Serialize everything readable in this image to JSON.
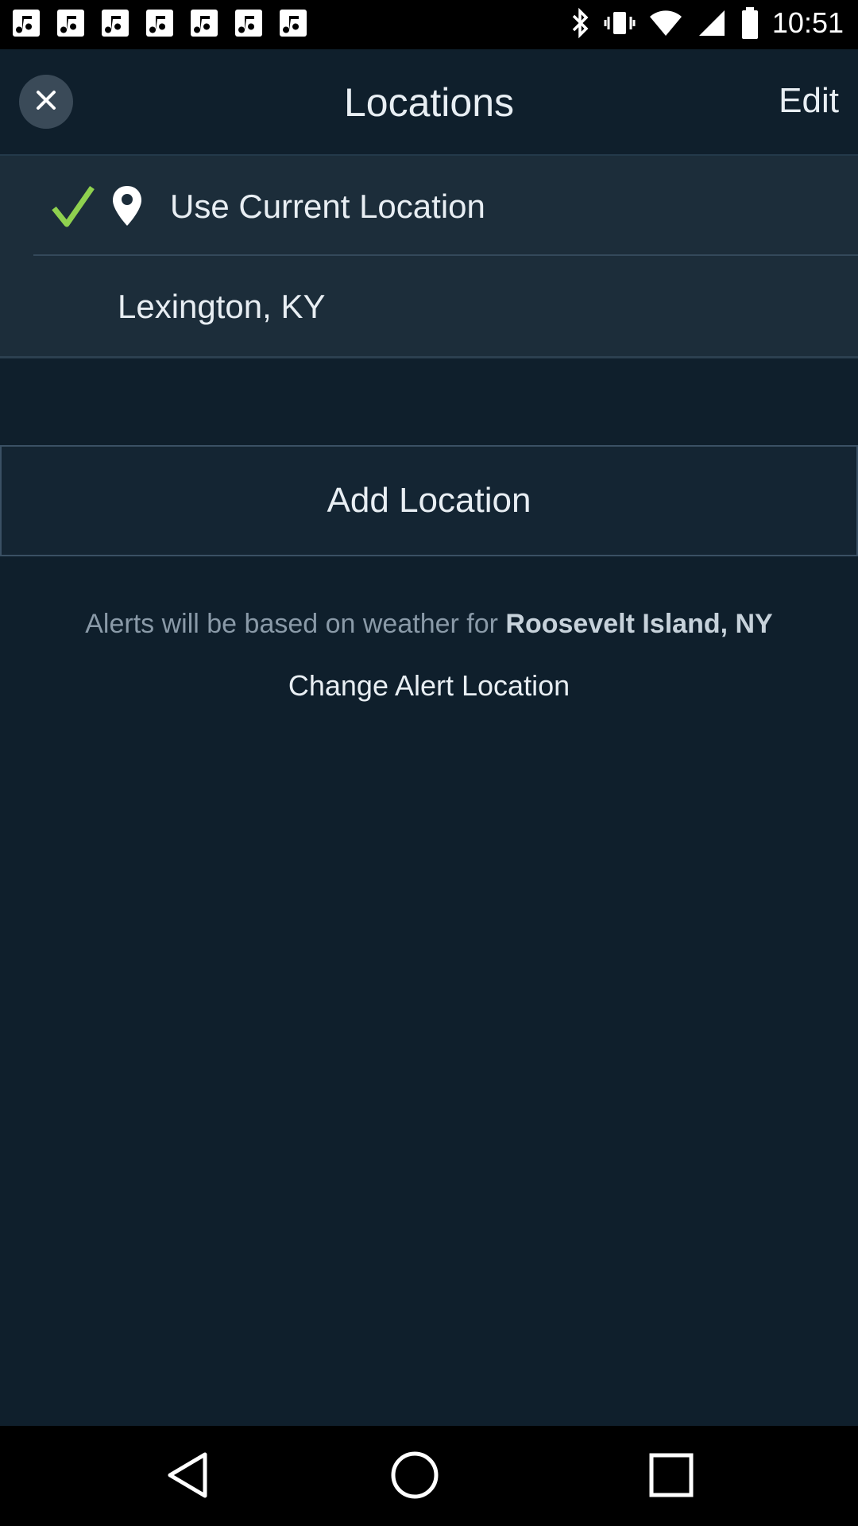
{
  "status_bar": {
    "time": "10:51",
    "notification_icons": [
      "music-note-icon",
      "music-note-icon",
      "music-note-icon",
      "music-note-icon",
      "music-note-icon",
      "music-note-icon",
      "music-note-icon"
    ],
    "right_icons": [
      "bluetooth-icon",
      "vibrate-icon",
      "wifi-icon",
      "signal-icon",
      "battery-icon"
    ]
  },
  "header": {
    "title": "Locations",
    "edit_label": "Edit"
  },
  "locations": {
    "current_label": "Use Current Location",
    "items": [
      {
        "label": "Lexington, KY"
      }
    ]
  },
  "add_location_label": "Add Location",
  "alerts": {
    "prefix": "Alerts will be based on weather for ",
    "city": "Roosevelt Island, NY",
    "change_label": "Change Alert Location"
  },
  "colors": {
    "background": "#0f1f2c",
    "list_background": "#1c2d3a",
    "check": "#8fd14f"
  }
}
